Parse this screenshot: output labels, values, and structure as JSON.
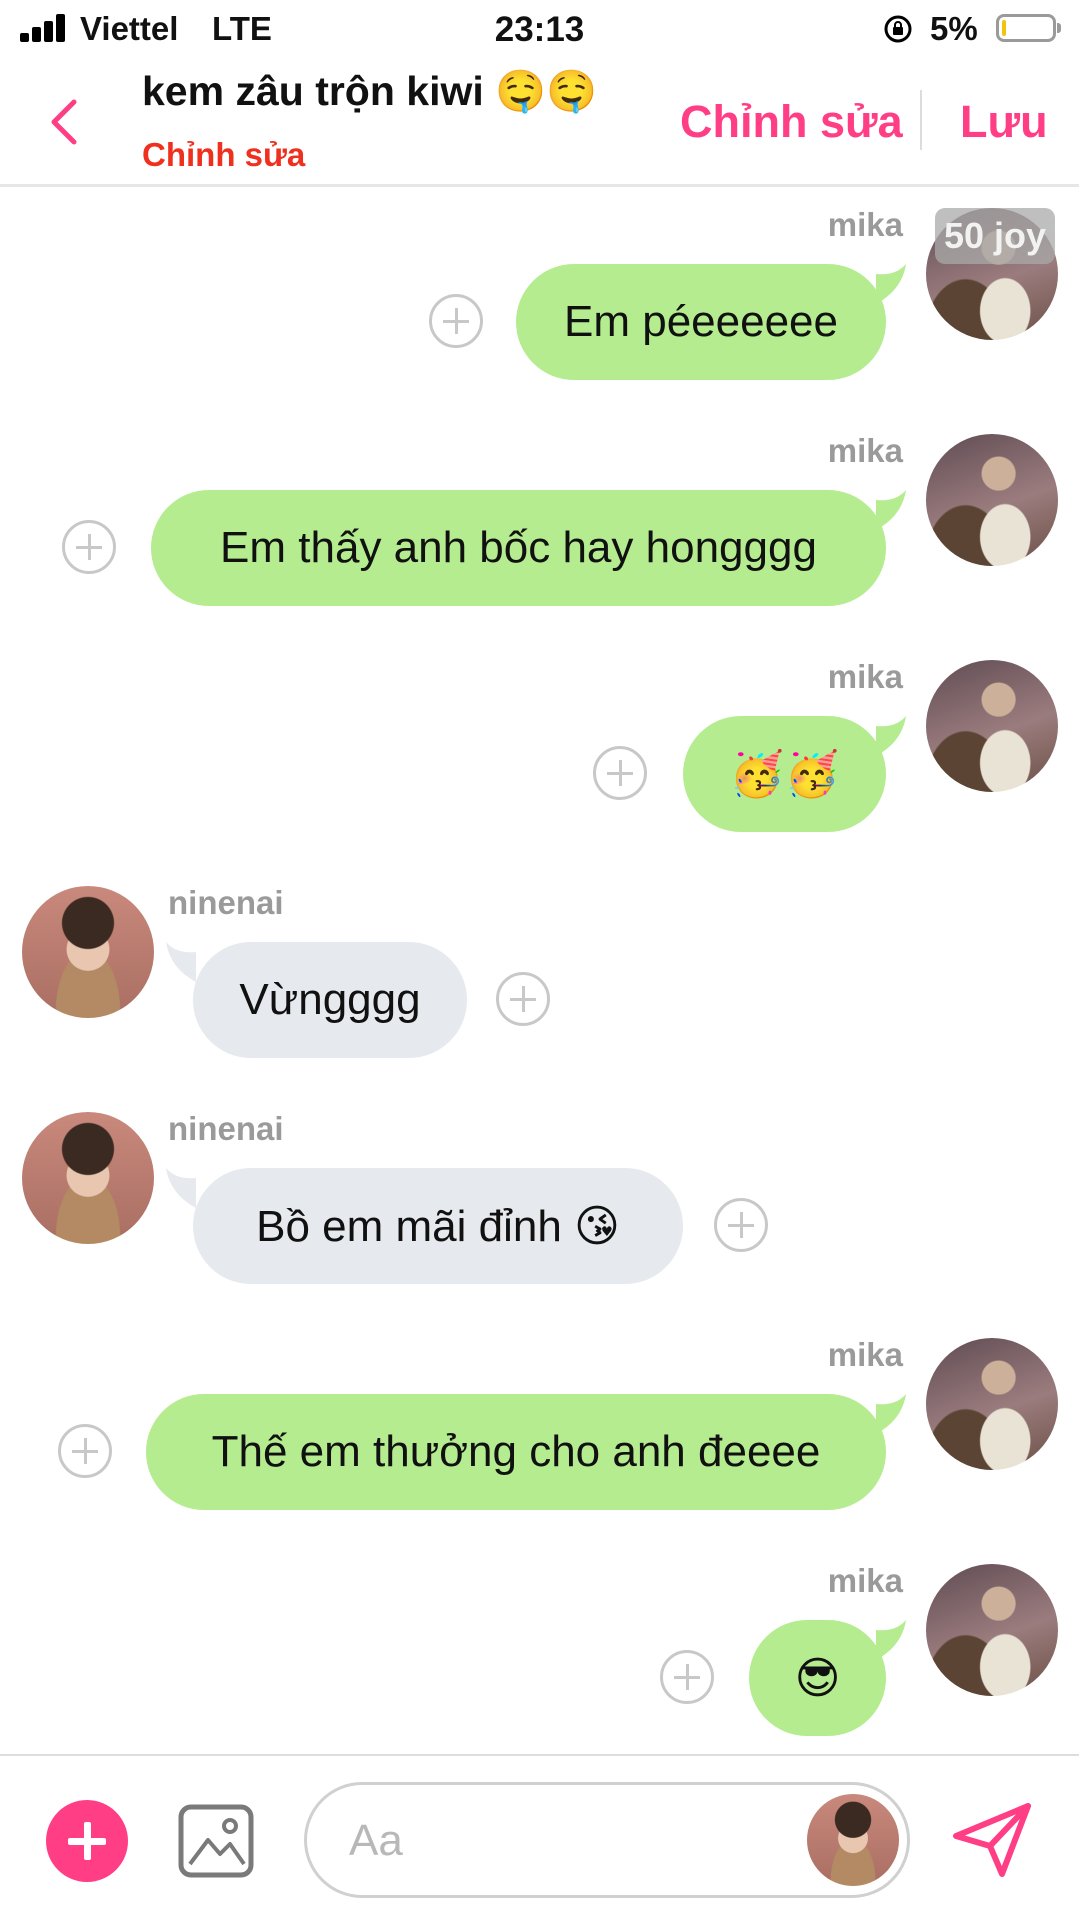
{
  "status_bar": {
    "carrier": "Viettel",
    "network": "LTE",
    "time": "23:13",
    "battery": "5%",
    "battery_level": 0.05
  },
  "header": {
    "title": "kem zâu trộn kiwi 🤤🤤",
    "subtitle": "Chỉnh sửa",
    "edit_label": "Chỉnh sửa",
    "save_label": "Lưu",
    "accent_color": "#ff3e86"
  },
  "joy_badge": "50 joy",
  "messages": [
    {
      "sender": "mika",
      "text": "Em péeeeeee",
      "side": "out"
    },
    {
      "sender": "mika",
      "text": "Em thấy anh bốc hay hongggg",
      "side": "out"
    },
    {
      "sender": "mika",
      "text": "🥳🥳",
      "side": "out"
    },
    {
      "sender": "ninenai",
      "text": "Vừngggg",
      "side": "in"
    },
    {
      "sender": "ninenai",
      "text": "Bồ em mãi đỉnh 😘",
      "side": "in"
    },
    {
      "sender": "mika",
      "text": "Thế em thưởng cho anh đeeee",
      "side": "out"
    },
    {
      "sender": "mika",
      "text": "😎",
      "side": "out"
    }
  ],
  "composer": {
    "placeholder": "Aa"
  },
  "colors": {
    "outgoing_bubble": "#b4ec8f",
    "incoming_bubble": "#e6e9ed",
    "subtitle": "#f0301e"
  }
}
